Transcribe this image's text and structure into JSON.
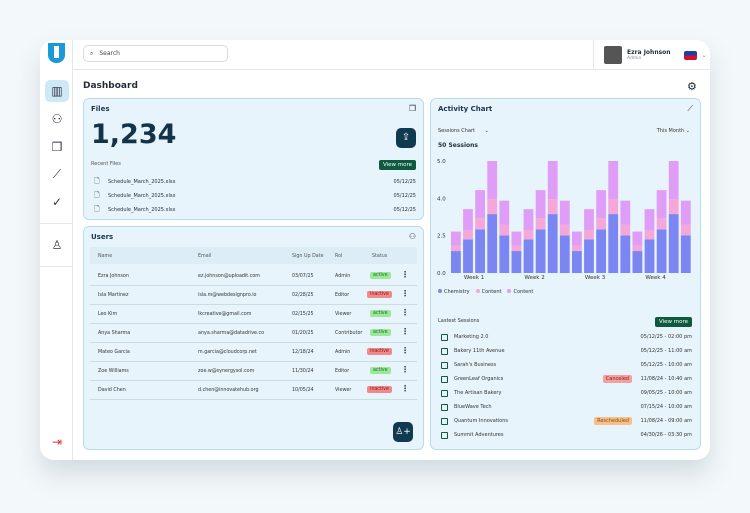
{
  "header": {
    "search_placeholder": "Search",
    "user_name": "Ezra Johnson",
    "user_role": "Admin"
  },
  "page_title": "Dashboard",
  "sidebar": {
    "items": [
      "dashboard",
      "users",
      "files",
      "analytics",
      "tasks",
      "profile",
      "logout"
    ]
  },
  "files": {
    "title": "Files",
    "count": "1,234",
    "recent_label": "Recent Files",
    "view_more": "View more",
    "items": [
      {
        "name": "Schedule_March_2025.xlsx",
        "date": "05/12/25"
      },
      {
        "name": "Schedule_March_2025.xlsx",
        "date": "05/12/25"
      },
      {
        "name": "Schedule_March_2025.xlsx",
        "date": "05/12/25"
      }
    ]
  },
  "users": {
    "title": "Users",
    "columns": [
      "Name",
      "Email",
      "Sign Up Date",
      "Rol",
      "Status"
    ],
    "rows": [
      {
        "name": "Ezra Johnson",
        "email": "ez.johnson@uploadit.com",
        "date": "03/07/25",
        "role": "Admin",
        "status": "active"
      },
      {
        "name": "Isla Martinez",
        "email": "isla.m@webdesignpro.io",
        "date": "02/28/25",
        "role": "Editor",
        "status": "inactive"
      },
      {
        "name": "Leo Kim",
        "email": "lkcreative@gmail.com",
        "date": "02/15/25",
        "role": "Viewer",
        "status": "active"
      },
      {
        "name": "Anya Sharma",
        "email": "anya.sharma@datadrive.co",
        "date": "01/20/25",
        "role": "Contributor",
        "status": "active"
      },
      {
        "name": "Mateo Garcia",
        "email": "m.garcia@cloudcorp.net",
        "date": "12/18/24",
        "role": "Admin",
        "status": "inactive"
      },
      {
        "name": "Zoe Williams",
        "email": "zoe.w@synergysol.com",
        "date": "11/30/24",
        "role": "Editor",
        "status": "active"
      },
      {
        "name": "David Chen",
        "email": "d.chen@innovatehub.org",
        "date": "10/05/24",
        "role": "Viewer",
        "status": "inactive"
      }
    ]
  },
  "activity": {
    "title": "Activity Chart",
    "chart_select": "Sessions Chart",
    "period_select": "This Month",
    "sessions_label": "50 Sessions"
  },
  "chart_data": {
    "type": "bar",
    "stacked": true,
    "categories": [
      "Week 1",
      "Week 2",
      "Week 3",
      "Week 4"
    ],
    "y_ticks": [
      "0.0",
      "2.5",
      "4.0",
      "5.0"
    ],
    "ylim": [
      0,
      5
    ],
    "series": [
      {
        "name": "Chemistry",
        "color": "#7c86f2",
        "values": [
          0.98,
          1.5,
          1.95,
          2.63,
          1.68,
          0.98,
          1.5,
          1.95,
          2.63,
          1.68,
          0.98,
          1.5,
          1.95,
          2.63,
          1.68,
          0.98,
          1.5,
          1.95,
          2.63,
          1.68
        ]
      },
      {
        "name": "Content",
        "color": "#f4a7d8",
        "values": [
          0.24,
          0.42,
          0.5,
          0.67,
          0.47,
          0.24,
          0.42,
          0.5,
          0.67,
          0.47,
          0.24,
          0.42,
          0.5,
          0.67,
          0.47,
          0.24,
          0.42,
          0.5,
          0.67,
          0.47
        ]
      },
      {
        "name": "Content",
        "color": "#df9df7",
        "values": [
          0.63,
          0.93,
          1.25,
          1.7,
          1.08,
          0.63,
          0.93,
          1.25,
          1.7,
          1.08,
          0.63,
          0.93,
          1.25,
          1.7,
          1.08,
          0.63,
          0.93,
          1.25,
          1.7,
          1.08
        ]
      }
    ],
    "legend_position": "bottom-left",
    "grid": false
  },
  "sessions": {
    "title": "Lastest Sessions",
    "view_more": "View more",
    "items": [
      {
        "name": "Marketing 2.0",
        "time": "05/12/25 - 02:00 pm",
        "tag": ""
      },
      {
        "name": "Bakery 11th Avenue",
        "time": "05/12/25 - 11:00 am",
        "tag": ""
      },
      {
        "name": "Sarah's Business",
        "time": "05/12/25 - 10:00 am",
        "tag": ""
      },
      {
        "name": "GreenLeaf Organics",
        "time": "11/08/24 - 10:40 am",
        "tag": "Canceled"
      },
      {
        "name": "The Artisan Bakery",
        "time": "09/05/25 - 10:00 am",
        "tag": ""
      },
      {
        "name": "BlueWave Tech",
        "time": "07/15/24 - 10:00 am",
        "tag": ""
      },
      {
        "name": "Quantum Innovations",
        "time": "11/08/24 - 09:00 am",
        "tag": "Rescheduled"
      },
      {
        "name": "Summit Adventures",
        "time": "04/30/26 - 03:30 pm",
        "tag": ""
      }
    ]
  },
  "colors": {
    "accent": "#1a9ad9",
    "dark_button": "#0f3a4f",
    "green": "#0e5a3c",
    "active": "#9be89a",
    "inactive": "#f08a8a",
    "canceled": "#f2a0a0",
    "rescheduled": "#f5c08a"
  }
}
